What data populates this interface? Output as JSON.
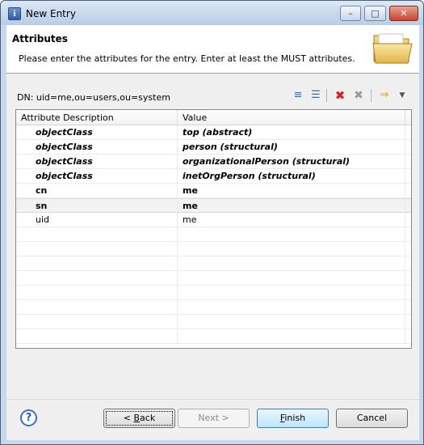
{
  "window": {
    "title": "New Entry",
    "minimize": "–",
    "maximize": "□",
    "close": "✕"
  },
  "banner": {
    "title": "Attributes",
    "description": "Please enter the attributes for the entry. Enter at least the MUST attributes.",
    "icon": "folder-icon"
  },
  "dn": {
    "label": "DN: uid=me,ou=users,ou=system"
  },
  "toolbar": {
    "new_value_icon": "new-value-icon",
    "edit_value_icon": "edit-value-icon",
    "delete_icon": "delete-icon",
    "delete_all_icon": "delete-all-icon",
    "show_all_icon": "show-all-icon",
    "menu_icon": "view-menu-icon"
  },
  "table": {
    "columns": [
      "Attribute Description",
      "Value"
    ],
    "rows": [
      {
        "attr": "objectClass",
        "value": "top (abstract)",
        "style": "bi"
      },
      {
        "attr": "objectClass",
        "value": "person (structural)",
        "style": "bi"
      },
      {
        "attr": "objectClass",
        "value": "organizationalPerson (structural)",
        "style": "bi"
      },
      {
        "attr": "objectClass",
        "value": "inetOrgPerson (structural)",
        "style": "bi"
      },
      {
        "attr": "cn",
        "value": "me",
        "style": "b"
      },
      {
        "attr": "sn",
        "value": "me",
        "style": "b",
        "selected": true
      },
      {
        "attr": "uid",
        "value": "me",
        "style": ""
      }
    ],
    "empty_rows": 8
  },
  "buttons": {
    "back_prefix": "< ",
    "back_mnemonic": "B",
    "back_rest": "ack",
    "next_label": "Next >",
    "finish_mnemonic": "F",
    "finish_rest": "inish",
    "cancel_label": "Cancel",
    "help_label": "?"
  },
  "colors": {
    "selection_row": "#f2f2f2",
    "finish_button": "#bee6fd",
    "delete_icon": "#d2221d"
  }
}
